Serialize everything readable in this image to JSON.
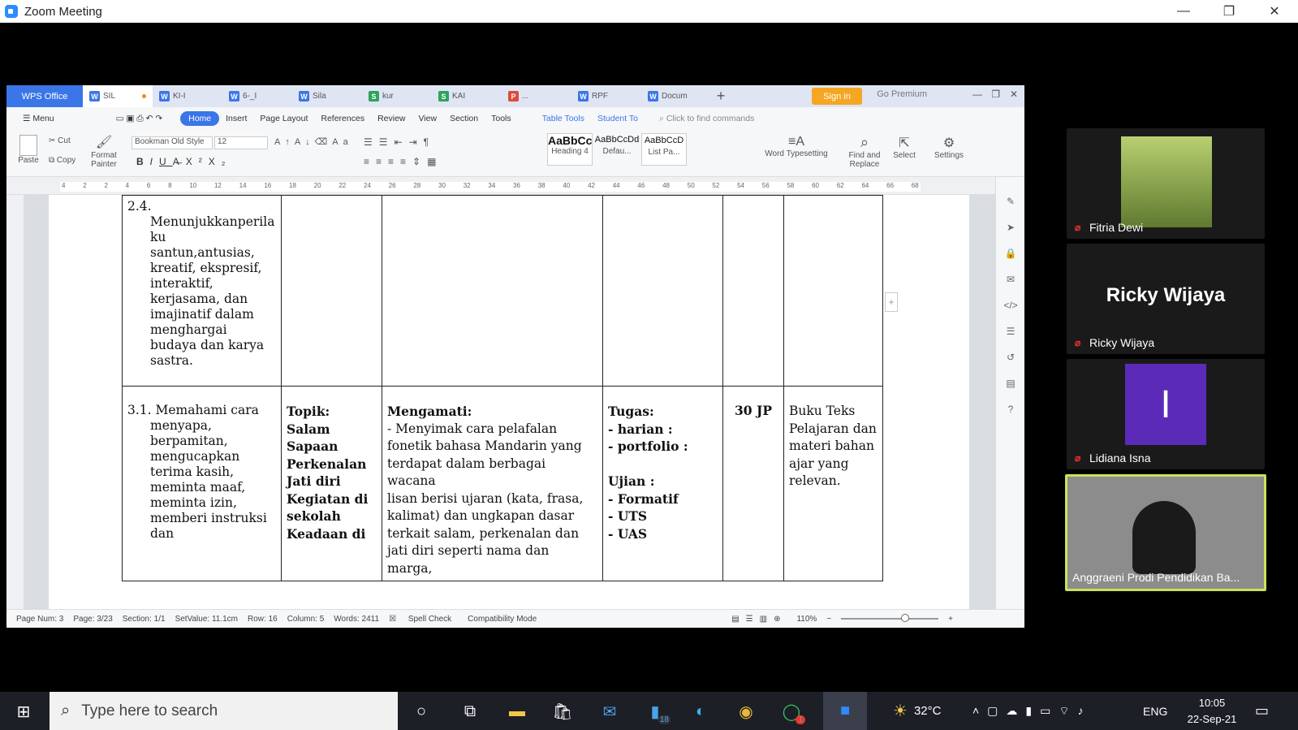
{
  "zoom": {
    "title": "Zoom Meeting",
    "min": "—",
    "restore": "❐",
    "close": "✕"
  },
  "wps": {
    "brand": "WPS Office",
    "tabs": [
      {
        "label": "SIL",
        "color": "#3b76e8",
        "letter": "W"
      },
      {
        "label": "KI-I",
        "color": "#3b76e8",
        "letter": "W"
      },
      {
        "label": "6-_I",
        "color": "#3b76e8",
        "letter": "W"
      },
      {
        "label": "Sila",
        "color": "#3b76e8",
        "letter": "W"
      },
      {
        "label": "kur",
        "color": "#2ea35c",
        "letter": "S"
      },
      {
        "label": "KAI",
        "color": "#2ea35c",
        "letter": "S"
      },
      {
        "label": "...",
        "color": "#e04a3c",
        "letter": "P"
      },
      {
        "label": "RPF",
        "color": "#3b76e8",
        "letter": "W"
      },
      {
        "label": "Docum",
        "color": "#3b76e8",
        "letter": "W"
      }
    ],
    "sign_in": "Sign in",
    "go_premium": "Go Premium",
    "menu": [
      "Menu",
      "Home",
      "Insert",
      "Page Layout",
      "References",
      "Review",
      "View",
      "Section",
      "Tools",
      "Table Tools",
      "Student To"
    ],
    "search_cmd": "Click to find commands",
    "ribbon": {
      "paste": "Paste",
      "cut": "Cut",
      "copy": "Copy",
      "format_painter_1": "Format",
      "format_painter_2": "Painter",
      "font": "Bookman Old Style",
      "size": "12",
      "styles": [
        {
          "sample": "AaBbCc",
          "name": "Heading 4"
        },
        {
          "sample": "AaBbCcDd",
          "name": "Defau..."
        },
        {
          "sample": "AaBbCcD",
          "name": "List Pa..."
        }
      ],
      "word_typesetting": "Word Typesetting",
      "find_replace_1": "Find and",
      "find_replace_2": "Replace",
      "select": "Select",
      "settings": "Settings"
    },
    "ruler_ticks": [
      "4",
      "2",
      "2",
      "4",
      "6",
      "8",
      "10",
      "12",
      "14",
      "16",
      "18",
      "20",
      "22",
      "24",
      "26",
      "28",
      "30",
      "32",
      "34",
      "36",
      "38",
      "40",
      "42",
      "44",
      "46",
      "48",
      "50",
      "52",
      "54",
      "56",
      "58",
      "60",
      "62",
      "64",
      "66",
      "68"
    ],
    "status": {
      "page_num": "Page Num: 3",
      "page": "Page: 3/23",
      "section": "Section: 1/1",
      "setvalue": "SetValue: 11.1cm",
      "row": "Row: 16",
      "column": "Column: 5",
      "words": "Words: 2411",
      "spell": "Spell Check",
      "compat": "Compatibility Mode",
      "zoom": "110%"
    },
    "doc": {
      "row1_col1": [
        "2.4.",
        "Menunjukkanperila",
        "ku",
        "santun,antusias,",
        "kreatif, ekspresif,",
        "interaktif,",
        "kerjasama, dan",
        "imajinatif dalam",
        "menghargai",
        "budaya dan karya",
        "sastra."
      ],
      "row2_col1": [
        "3.1. Memahami cara",
        "menyapa,",
        "berpamitan,",
        "mengucapkan",
        "terima kasih,",
        "meminta maaf,",
        "meminta izin,",
        "memberi instruksi",
        "dan"
      ],
      "row2_col2": [
        "Topik:",
        "Salam",
        "Sapaan",
        "Perkenalan",
        "Jati diri",
        "Kegiatan di",
        "sekolah",
        "Keadaan di"
      ],
      "row2_col3_title": "Mengamati:",
      "row2_col3": [
        "- Menyimak cara pelafalan",
        "fonetik bahasa Mandarin yang",
        "terdapat dalam berbagai wacana",
        "lisan berisi  ujaran (kata, frasa,",
        "kalimat) dan ungkapan dasar",
        "terkait salam, perkenalan dan",
        "jati diri seperti nama dan marga,"
      ],
      "row2_col4": [
        "Tugas:",
        "- harian :",
        "- portfolio :",
        "",
        "Ujian :",
        "- Formatif",
        "- UTS",
        "- UAS"
      ],
      "row2_col5": "30 JP",
      "row2_col6": [
        "Buku Teks",
        "Pelajaran dan",
        "materi bahan",
        "ajar yang",
        "relevan."
      ]
    }
  },
  "participants": [
    {
      "name": "Fitria Dewi"
    },
    {
      "name": "Ricky Wijaya",
      "big": "Ricky Wijaya"
    },
    {
      "name": "Lidiana Isna",
      "initial": "I"
    },
    {
      "name": "Anggraeni Prodi Pendidikan Ba..."
    }
  ],
  "taskbar": {
    "search": "Type here to search",
    "mail_badge": "18",
    "whatsapp_badge": "1",
    "temp": "32°C",
    "lang": "ENG",
    "time": "10:05",
    "date": "22-Sep-21"
  }
}
